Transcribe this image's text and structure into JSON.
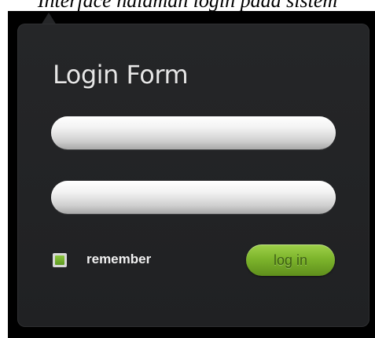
{
  "page": {
    "caption": "Interface halaman login pada sistem"
  },
  "login_form": {
    "title": "Login Form",
    "username": {
      "value": "",
      "placeholder": ""
    },
    "password": {
      "value": "",
      "placeholder": ""
    },
    "remember": {
      "label": "remember",
      "checked": true
    },
    "submit_label": "log in"
  },
  "colors": {
    "panel_background": "#232426",
    "accent_green": "#7db52c",
    "title_text": "#e6e6e6"
  }
}
